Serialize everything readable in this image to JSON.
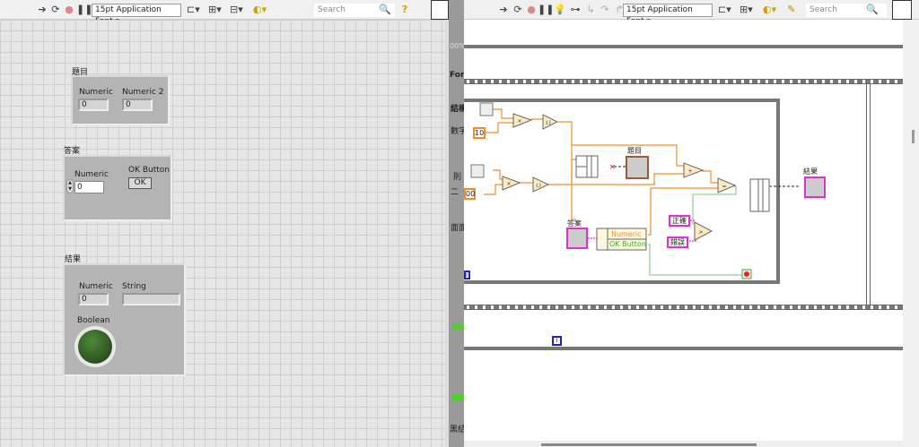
{
  "front_panel": {
    "toolbar": {
      "font": "15pt Application Font",
      "search_placeholder": "Search",
      "help": "?"
    },
    "cluster_question": {
      "label": "題目",
      "numeric_label": "Numeric",
      "numeric_value": "0",
      "numeric2_label": "Numeric 2",
      "numeric2_value": "0"
    },
    "cluster_answer": {
      "label": "答案",
      "numeric_label": "Numeric",
      "numeric_value": "0",
      "button_label": "OK Button",
      "button_text": "OK"
    },
    "cluster_result": {
      "label": "結果",
      "numeric_label": "Numeric",
      "numeric_value": "0",
      "string_label": "String",
      "string_value": "",
      "boolean_label": "Boolean",
      "led_color": "#2f5a22"
    }
  },
  "block_diagram": {
    "toolbar": {
      "font": "15pt Application Font",
      "search_placeholder": "Search",
      "help": "?"
    },
    "constants": {
      "c10": "10",
      "c100": "00",
      "correct": "正確",
      "wrong": "錯誤"
    },
    "nodes": {
      "question_label": "題目",
      "answer_label": "答案",
      "result_label": "結果",
      "unbundle_numeric": "Numeric",
      "unbundle_ok": "OK Button",
      "loop_index": "i",
      "loop_index2": "i"
    },
    "side_text": [
      "00%",
      "For",
      "結構",
      "數字",
      "則",
      "二",
      "面面",
      "黑結"
    ],
    "wire_colors": {
      "numeric": "#f08c28",
      "boolean": "#7cc07c",
      "string": "#e030d0"
    }
  }
}
